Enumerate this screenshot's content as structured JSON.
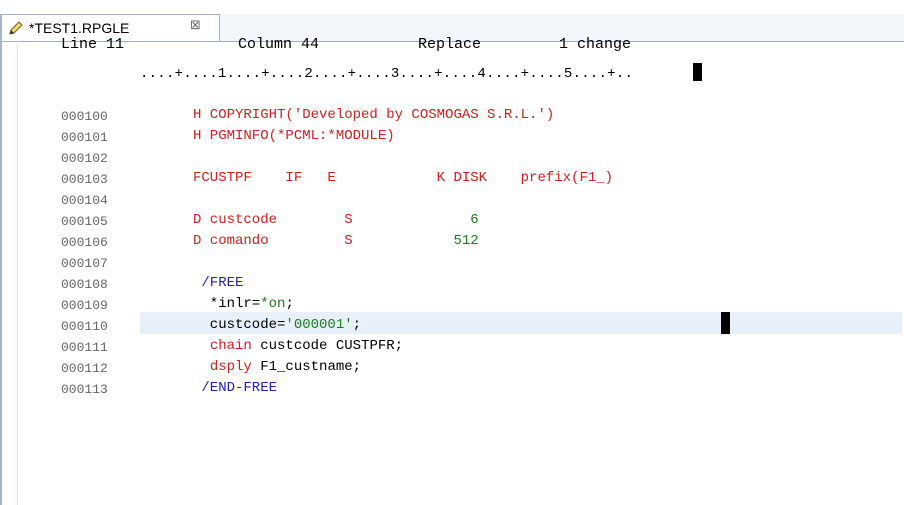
{
  "tab": {
    "title": "*TEST1.RPGLE",
    "close": "⊠",
    "icon": "pencil-icon"
  },
  "status": {
    "line": "Line 11",
    "column": "Column 44",
    "mode": "Replace",
    "changes": "1 change"
  },
  "ruler": "....+....1....+....2....+....3....+....4....+....5....+..",
  "lines": [
    {
      "seq": "000100",
      "text": "H COPYRIGHT('Developed by COSMOGAS S.R.L.')"
    },
    {
      "seq": "000101",
      "text": "H PGMINFO(*PCML:*MODULE)"
    },
    {
      "seq": "000102",
      "text": ""
    },
    {
      "seq": "000103",
      "text": "FCUSTPF    IF   E            K DISK    prefix(F1_)"
    },
    {
      "seq": "000104",
      "text": ""
    },
    {
      "seq": "000105",
      "text": "D custcode        S              6"
    },
    {
      "seq": "000106",
      "text": "D comando         S            512"
    },
    {
      "seq": "000107",
      "text": ""
    },
    {
      "seq": "000108",
      "text": " /FREE"
    },
    {
      "seq": "000109",
      "text": "  *inlr=*on;"
    },
    {
      "seq": "000110",
      "text": "  custcode='000001';"
    },
    {
      "seq": "000111",
      "text": "  chain custcode CUSTPFR;"
    },
    {
      "seq": "000112",
      "text": "  dsply F1_custname;"
    },
    {
      "seq": "000113",
      "text": " /END-FREE"
    }
  ],
  "colors": {
    "keyword_red": "#d21d1d",
    "keyword_blue": "#1f1fb4",
    "number_green": "#1b7c1b",
    "current_line": "#e8f0fb"
  }
}
